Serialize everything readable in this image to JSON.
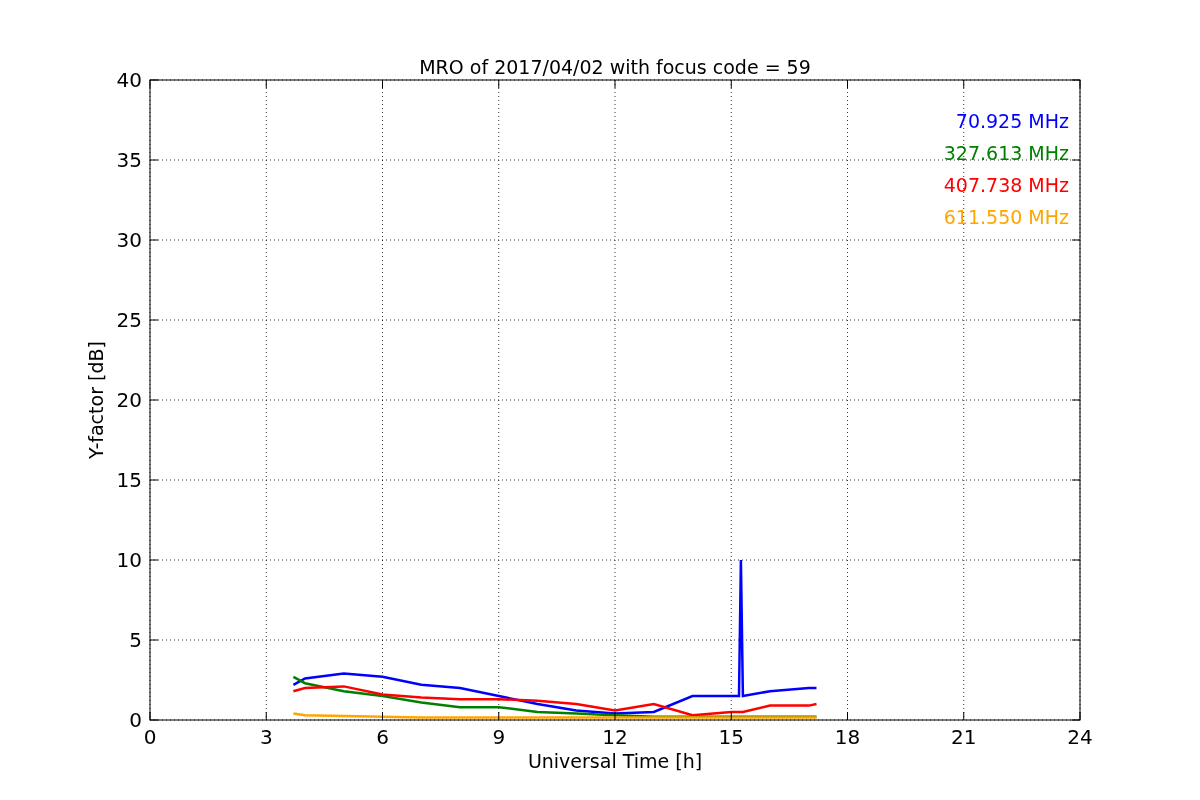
{
  "chart_data": {
    "type": "line",
    "title": "MRO of 2017/04/02 with focus code = 59",
    "xlabel": "Universal Time [h]",
    "ylabel": "Y-factor [dB]",
    "x": [
      3.7,
      4,
      5,
      6,
      7,
      8,
      9,
      10,
      11,
      12,
      13,
      14,
      15,
      15.2,
      15.25,
      15.3,
      16,
      17,
      17.2
    ],
    "series": [
      {
        "name": "70.925 MHz",
        "color": "#0000ff",
        "values": [
          2.2,
          2.6,
          2.9,
          2.7,
          2.2,
          2.0,
          1.5,
          1.0,
          0.6,
          0.4,
          0.5,
          1.5,
          1.5,
          1.5,
          10,
          1.5,
          1.8,
          2.0,
          2.0
        ]
      },
      {
        "name": "327.613 MHz",
        "color": "#008000",
        "values": [
          2.7,
          2.3,
          1.8,
          1.5,
          1.1,
          0.8,
          0.8,
          0.5,
          0.4,
          0.3,
          0.2,
          0.2,
          0.2,
          0.2,
          0.2,
          0.2,
          0.2,
          0.2,
          0.2
        ]
      },
      {
        "name": "407.738 MHz",
        "color": "#ff0000",
        "values": [
          1.8,
          2.0,
          2.1,
          1.6,
          1.4,
          1.3,
          1.3,
          1.2,
          1.0,
          0.6,
          1.0,
          0.3,
          0.5,
          0.5,
          0.5,
          0.5,
          0.9,
          0.9,
          1.0
        ]
      },
      {
        "name": "611.550 MHz",
        "color": "#ffa500",
        "values": [
          0.4,
          0.3,
          0.25,
          0.2,
          0.15,
          0.15,
          0.15,
          0.15,
          0.15,
          0.15,
          0.15,
          0.15,
          0.15,
          0.15,
          0.15,
          0.15,
          0.15,
          0.15,
          0.15
        ]
      }
    ],
    "grid": true,
    "xlim": [
      0,
      24
    ],
    "ylim": [
      0,
      40
    ],
    "xticks": [
      0,
      3,
      6,
      9,
      12,
      15,
      18,
      21,
      24
    ],
    "yticks": [
      0,
      5,
      10,
      15,
      20,
      25,
      30,
      35,
      40
    ]
  }
}
